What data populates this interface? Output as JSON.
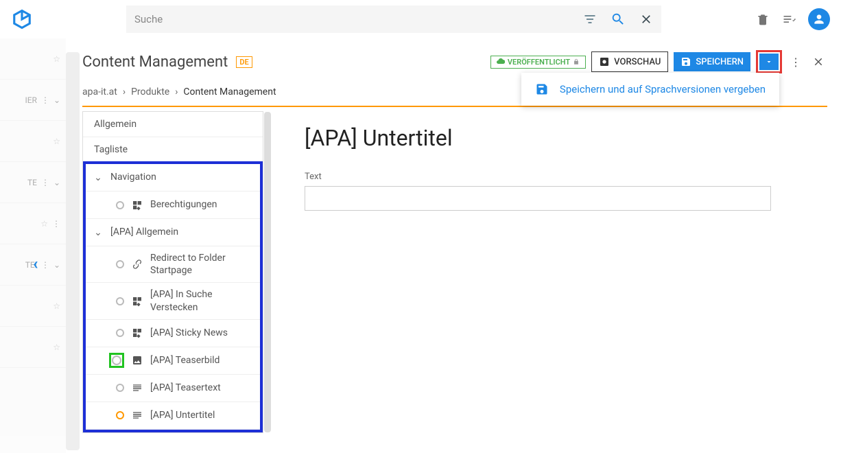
{
  "search": {
    "placeholder": "Suche"
  },
  "page": {
    "title": "Content Management",
    "lang": "DE"
  },
  "status": {
    "published": "VERÖFFENTLICHT"
  },
  "actions": {
    "preview": "VORSCHAU",
    "save": "SPEICHERN"
  },
  "dropdown": {
    "save_langs": "Speichern und auf Sprachversionen vergeben"
  },
  "breadcrumb": {
    "a": "apa-it.at",
    "b": "Produkte",
    "c": "Content Management"
  },
  "sidepanel": {
    "allgemein": "Allgemein",
    "tagliste": "Tagliste"
  },
  "tree": {
    "navigation": "Navigation",
    "berechtigungen": "Berechtigungen",
    "apa_allgemein": "[APA] Allgemein",
    "redirect": "Redirect to Folder Startpage",
    "suche_verstecken": "[APA] In Suche Verstecken",
    "sticky": "[APA] Sticky News",
    "teaserbild": "[APA] Teaserbild",
    "teasertext": "[APA] Teasertext",
    "untertitel": "[APA] Untertitel"
  },
  "editor": {
    "heading": "[APA] Untertitel",
    "text_label": "Text"
  },
  "rail": {
    "item1": "IER",
    "item2": "TE",
    "item3": "TEI"
  }
}
